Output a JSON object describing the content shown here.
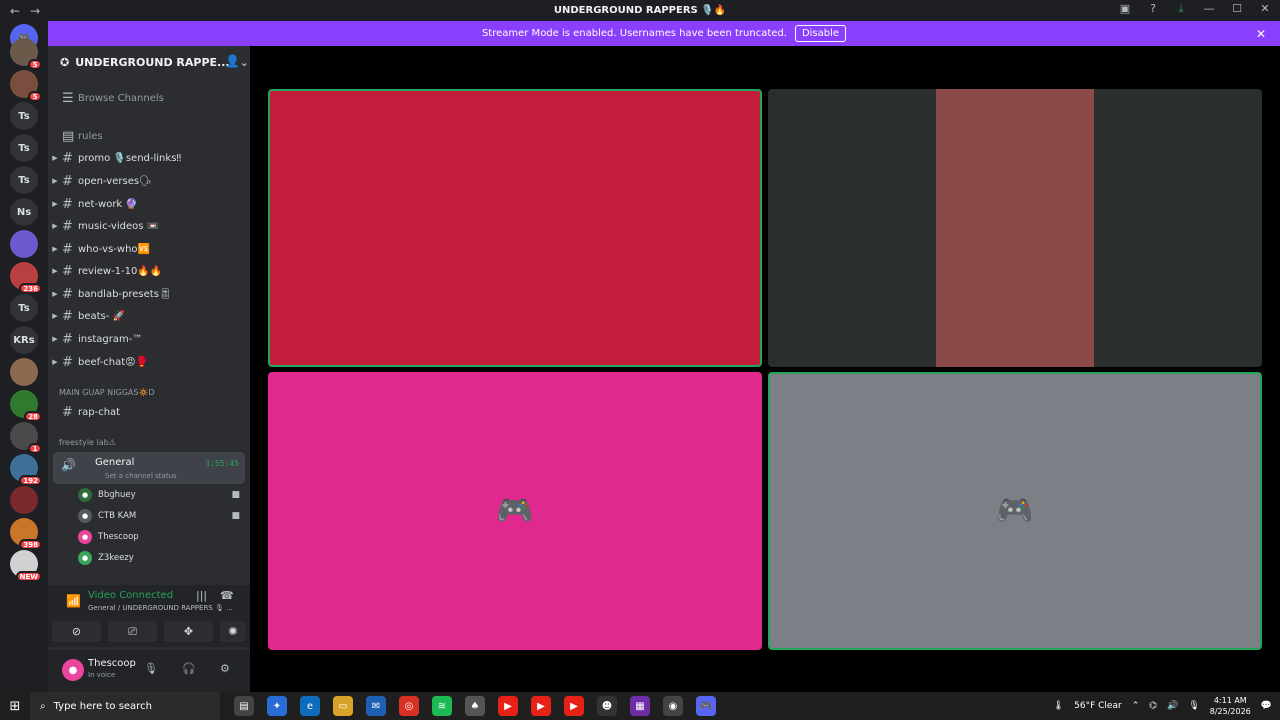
{
  "window": {
    "title": "UNDERGROUND RAPPERS 🎙️🔥"
  },
  "banner": {
    "text": "Streamer Mode is enabled. Usernames have been truncated.",
    "disable_label": "Disable"
  },
  "guilds": [
    {
      "label": "",
      "badge": "5"
    },
    {
      "label": "",
      "badge": "5"
    },
    {
      "label": "Ts",
      "badge": ""
    },
    {
      "label": "Ts",
      "badge": ""
    },
    {
      "label": "Ts",
      "badge": ""
    },
    {
      "label": "Ns",
      "badge": ""
    },
    {
      "label": "",
      "badge": ""
    },
    {
      "label": "",
      "badge": "236"
    },
    {
      "label": "Ts",
      "badge": ""
    },
    {
      "label": "KRs",
      "badge": ""
    },
    {
      "label": "",
      "badge": ""
    },
    {
      "label": "",
      "badge": "28"
    },
    {
      "label": "",
      "badge": "1"
    },
    {
      "label": "",
      "badge": "192"
    },
    {
      "label": "",
      "badge": ""
    },
    {
      "label": "",
      "badge": "398"
    },
    {
      "label": "",
      "badge": "NEW"
    }
  ],
  "server": {
    "name": "UNDERGROUND RAPPE..."
  },
  "browse": "Browse Channels",
  "channels": [
    {
      "name": "rules"
    },
    {
      "name": "promo 🎙️send-links‼"
    },
    {
      "name": "open-verses🗣"
    },
    {
      "name": "net-work 🔮"
    },
    {
      "name": "music-videos 📼"
    },
    {
      "name": "who-vs-who🆚"
    },
    {
      "name": "review-1-10🔥🔥"
    },
    {
      "name": "bandlab-presets🎚"
    },
    {
      "name": "beats- 🚀"
    },
    {
      "name": "instagram-™"
    },
    {
      "name": "beef-chat😡🥊"
    }
  ],
  "categories": {
    "main": "MAIN GUAP NIGGAS🔅D",
    "freestyle": "freestyle lab⚠"
  },
  "rap_chat": "rap-chat",
  "voice_channel": {
    "name": "General",
    "status": "Set a channel status",
    "time": "3:55:45"
  },
  "voice_users": [
    {
      "name": "Bbghuey",
      "color": "#2f6b3a"
    },
    {
      "name": "CTB KAM",
      "color": "#555a60"
    },
    {
      "name": "Thescoop",
      "color": "#eb459e"
    },
    {
      "name": "Z3keezy",
      "color": "#3ba55c"
    }
  ],
  "rtc": {
    "status": "Video Connected",
    "location": "General / UNDERGROUND RAPPERS 🎙 ..."
  },
  "user": {
    "name": "Thescoop",
    "status": "In voice"
  },
  "tiles": [
    {
      "color": "#c21d3a",
      "speaking": true
    },
    {
      "color": "#2a2e2c",
      "speaking": false
    },
    {
      "color": "#e0298f",
      "speaking": false
    },
    {
      "color": "#7c7f86",
      "speaking": true
    }
  ],
  "taskbar": {
    "search_placeholder": "Type here to search",
    "weather": "56°F  Clear",
    "time": "4:11 AM",
    "date": "8/25/2026"
  }
}
